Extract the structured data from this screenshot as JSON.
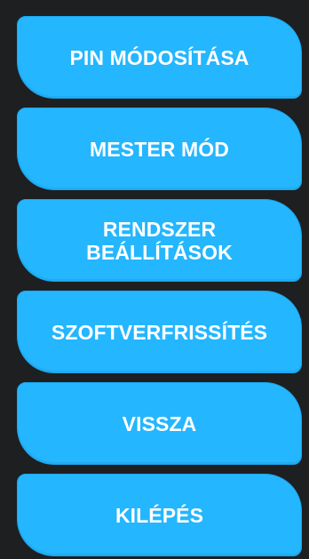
{
  "menu": {
    "buttons": [
      {
        "label": "PIN MÓDOSÍTÁSA"
      },
      {
        "label": "MESTER MÓD"
      },
      {
        "label": "RENDSZER\nBEÁLLÍTÁSOK"
      },
      {
        "label": "SZOFTVERFRISSÍTÉS"
      },
      {
        "label": "VISSZA"
      },
      {
        "label": "KILÉPÉS"
      }
    ]
  },
  "colors": {
    "background": "#1e1f21",
    "button": "#24b6ff",
    "button_text": "#ffffff"
  }
}
